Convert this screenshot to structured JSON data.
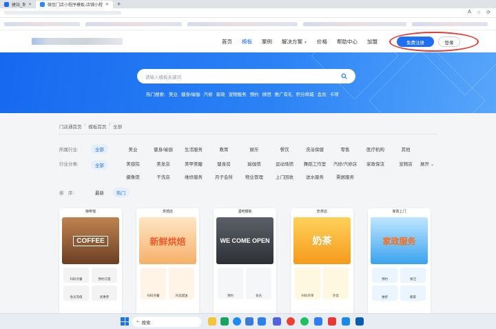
{
  "browser": {
    "tabs": [
      {
        "title": "建站_制作小程序",
        "active": false
      },
      {
        "title": "微信门店小程序模板-店铺小程序",
        "active": true
      }
    ],
    "new_tab": "+",
    "address_icons": [
      "A",
      "☆",
      "⟳"
    ]
  },
  "header": {
    "nav": [
      {
        "label": "首页",
        "active": false
      },
      {
        "label": "模板",
        "active": true
      },
      {
        "label": "案例",
        "active": false
      },
      {
        "label": "解决方案",
        "active": false,
        "dropdown": true
      },
      {
        "label": "价格",
        "active": false
      },
      {
        "label": "帮助中心",
        "active": false
      },
      {
        "label": "加盟",
        "active": false
      }
    ],
    "register_label": "免费注册",
    "login_label": "登录",
    "colors": {
      "accent": "#1f6ff2",
      "annotation": "#e53935"
    }
  },
  "hero": {
    "search_placeholder": "请输入模板关键词",
    "hot_label": "热门搜索:",
    "hot_terms": [
      "美业",
      "健身/瑜伽",
      "汽修",
      "家政",
      "宠物服务",
      "预约",
      "拼团",
      "推广有礼",
      "积分商城",
      "会员",
      "卡项"
    ]
  },
  "breadcrumb": [
    "门店通首页",
    "模板首页",
    "全部"
  ],
  "filters": {
    "industry": {
      "label": "所属行业:",
      "selected": "全部",
      "options": [
        "美业",
        "健身/瑜伽",
        "生活服务",
        "教育",
        "娱乐",
        "餐饮",
        "洗浴保健",
        "零售",
        "医疗机构",
        "其他"
      ]
    },
    "category": {
      "label": "行业分类:",
      "selected": "全部",
      "options": [
        "美容院",
        "美发店",
        "美甲美睫",
        "健身房",
        "瑜伽馆",
        "运动场馆",
        "舞蹈工作室",
        "汽修/汽修店",
        "家政保洁",
        "宠物店",
        "摄像馆",
        "干洗店",
        "维修服务",
        "月子会所",
        "物业管理",
        "上门回收",
        "送水服务",
        "票据服务"
      ],
      "expand_label": "展开"
    },
    "sort": {
      "label": "排　序:",
      "options": [
        "最新",
        "热门"
      ],
      "selected": "热门"
    }
  },
  "cards": [
    {
      "header": "咖啡馆",
      "poster": "COFFEE",
      "tiles": [
        "扫码点餐",
        "预约订座",
        "会员充值",
        "优惠券"
      ],
      "color": "#7a4b2a"
    },
    {
      "header": "烘焙店",
      "poster": "新鲜烘焙",
      "tiles": [
        "扫码点餐",
        "外卖配送"
      ],
      "color": "#f28a2e"
    },
    {
      "header": "酒吧模板",
      "poster": "WE COME OPEN",
      "tiles": [
        "预约",
        "会员"
      ],
      "color": "#3b3f45"
    },
    {
      "header": "奶茶店",
      "poster": "奶茶",
      "tiles": [
        "扫码点单",
        "外卖"
      ],
      "color": "#f7a61b"
    },
    {
      "header": "家政上门",
      "poster": "家政服务",
      "tiles": [
        "预约",
        "保洁",
        "维修",
        "搬家"
      ],
      "color": "#1f9be8"
    }
  ],
  "taskbar": {
    "search_label": "搜索"
  }
}
